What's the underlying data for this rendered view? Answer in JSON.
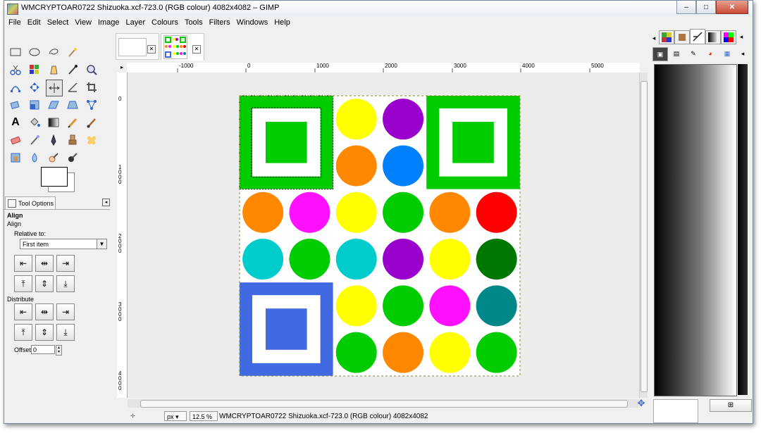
{
  "window": {
    "title": "WMCRYPTOAR0722 Shizuoka.xcf-723.0 (RGB colour) 4082x4082 – GIMP",
    "controls": {
      "minimize": "–",
      "maximize": "□",
      "close": "✕"
    }
  },
  "menu": [
    "File",
    "Edit",
    "Select",
    "View",
    "Image",
    "Layer",
    "Colours",
    "Tools",
    "Filters",
    "Windows",
    "Help"
  ],
  "toolbox": {
    "tools": [
      "rect-select-icon",
      "ellipse-select-icon",
      "lasso-icon",
      "fuzzy-select-icon",
      "",
      "scissors-icon",
      "by-color-select-icon",
      "foreground-select-icon",
      "color-picker-icon",
      "zoom-icon",
      "paths-icon",
      "move-icon",
      "align-icon",
      "measure-icon",
      "crop-icon",
      "rotate-icon",
      "scale-icon",
      "shear-icon",
      "perspective-icon",
      "cage-icon",
      "text-icon",
      "bucket-fill-icon",
      "blend-icon",
      "pencil-icon",
      "paintbrush-icon",
      "eraser-icon",
      "airbrush-icon",
      "ink-icon",
      "clone-icon",
      "heal-icon",
      "perspective-clone-icon",
      "smudge-icon",
      "dodge-icon",
      "burn-icon"
    ],
    "active_tool": "align-icon"
  },
  "tool_options": {
    "tab_label": "Tool Options",
    "header": "Align",
    "subheader": "Align",
    "relative_to_label": "Relative to:",
    "relative_to_value": "First item",
    "distribute_label": "Distribute",
    "offset_label": "Offset:",
    "offset_value": "0"
  },
  "image_tabs": [
    {
      "name": "blank-image-tab",
      "close": "✕"
    },
    {
      "name": "shizuoka-image-tab",
      "close": "✕"
    }
  ],
  "rulers": {
    "horizontal": [
      "-1000",
      "0",
      "1000",
      "2000",
      "3000",
      "4000",
      "5000"
    ],
    "vertical": [
      "0",
      "1000",
      "2000",
      "3000",
      "4000"
    ]
  },
  "canvas": {
    "colors": {
      "green": "#00cc00",
      "yellow": "#ffff00",
      "purple": "#9900cc",
      "orange": "#ff8800",
      "blue": "#0080ff",
      "magenta": "#ff11ff",
      "red": "#ff0000",
      "cyan": "#00cccc",
      "dark_green": "#007700",
      "teal": "#008888",
      "royal_blue": "#4169e1"
    },
    "circles": [
      {
        "row": 0,
        "col": 2,
        "color": "#ffff00"
      },
      {
        "row": 0,
        "col": 3,
        "color": "#9900cc"
      },
      {
        "row": 1,
        "col": 2,
        "color": "#ff8800"
      },
      {
        "row": 1,
        "col": 3,
        "color": "#0080ff"
      },
      {
        "row": 2,
        "col": 0,
        "color": "#ff8800"
      },
      {
        "row": 2,
        "col": 1,
        "color": "#ff11ff"
      },
      {
        "row": 2,
        "col": 2,
        "color": "#ffff00"
      },
      {
        "row": 2,
        "col": 3,
        "color": "#00cc00"
      },
      {
        "row": 2,
        "col": 4,
        "color": "#ff8800"
      },
      {
        "row": 2,
        "col": 5,
        "color": "#ff0000"
      },
      {
        "row": 3,
        "col": 0,
        "color": "#00cccc"
      },
      {
        "row": 3,
        "col": 1,
        "color": "#00cc00"
      },
      {
        "row": 3,
        "col": 2,
        "color": "#00cccc"
      },
      {
        "row": 3,
        "col": 3,
        "color": "#9900cc"
      },
      {
        "row": 3,
        "col": 4,
        "color": "#ffff00"
      },
      {
        "row": 3,
        "col": 5,
        "color": "#007700"
      },
      {
        "row": 4,
        "col": 2,
        "color": "#ffff00"
      },
      {
        "row": 4,
        "col": 3,
        "color": "#00cc00"
      },
      {
        "row": 4,
        "col": 4,
        "color": "#ff11ff"
      },
      {
        "row": 4,
        "col": 5,
        "color": "#008888"
      },
      {
        "row": 5,
        "col": 2,
        "color": "#00cc00"
      },
      {
        "row": 5,
        "col": 3,
        "color": "#ff8800"
      },
      {
        "row": 5,
        "col": 4,
        "color": "#ffff00"
      },
      {
        "row": 5,
        "col": 5,
        "color": "#00cc00"
      }
    ],
    "squares": [
      {
        "pos": "top-left",
        "color": "#00cc00",
        "selected": true
      },
      {
        "pos": "top-right",
        "color": "#00cc00",
        "selected": false
      },
      {
        "pos": "bottom-left",
        "color": "#4169e1",
        "selected": false
      }
    ]
  },
  "statusbar": {
    "unit": "px",
    "zoom": "12.5 %",
    "text": "WMCRYPTOAR0722 Shizuoka.xcf-723.0 (RGB colour) 4082x4082"
  },
  "dock": {
    "gradient": {
      "start": "#000000",
      "end": "#ffffff"
    }
  }
}
